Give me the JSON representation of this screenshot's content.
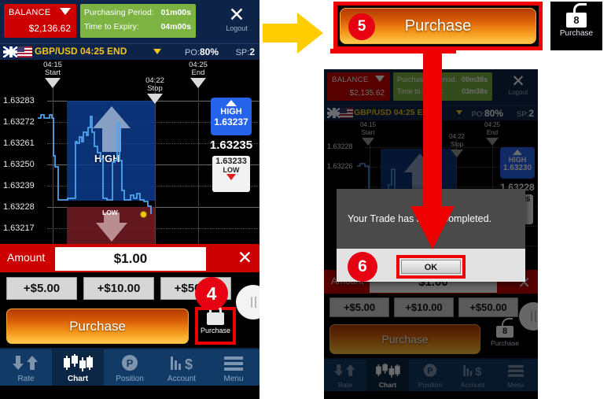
{
  "left_phone": {
    "header": {
      "balance_label": "BALANCE",
      "balance_value": "$2,136.62",
      "purchasing_period_label": "Purchasing Period:",
      "purchasing_period_value": "01m00s",
      "time_to_expiry_label": "Time to Expiry:",
      "time_to_expiry_value": "04m00s",
      "logout_label": "Logout",
      "close_icon": "close-x-icon"
    },
    "pair_bar": {
      "pair": "GBP/USD 04:25 END",
      "po_label": "PO:",
      "po_value": "80%",
      "sp_label": "SP:",
      "sp_value": "2"
    },
    "chart": {
      "markers": [
        {
          "time": "04:15",
          "name": "Start"
        },
        {
          "time": "04:22",
          "name": "Stop"
        },
        {
          "time": "04:25",
          "name": "End"
        }
      ],
      "high_zone_label": "HIGH",
      "low_zone_label": "LOW",
      "high_badge_label": "HIGH",
      "high_badge_value": "1.63237",
      "mid_value": "1.63235",
      "low_badge_value": "1.63233",
      "low_badge_label": "LOW"
    },
    "amount": {
      "label": "Amount",
      "value": "$1.00",
      "clear_icon": "close-x-icon"
    },
    "quick_buttons": [
      "+$5.00",
      "+$10.00",
      "+$50.00"
    ],
    "purchase_button": "Purchase",
    "lock": {
      "label": "Purchase",
      "icon": "padlock-closed-icon"
    },
    "nav": [
      {
        "label": "Rate",
        "icon": "arrows-up-down-icon",
        "active": false
      },
      {
        "label": "Chart",
        "icon": "candlestick-icon",
        "active": true
      },
      {
        "label": "Position",
        "icon": "p-circle-icon",
        "active": false
      },
      {
        "label": "Account",
        "icon": "bars-dollar-icon",
        "active": false
      },
      {
        "label": "Menu",
        "icon": "hamburger-icon",
        "active": false
      }
    ],
    "badge": "4"
  },
  "right_phone": {
    "header": {
      "balance_label": "BALANCE",
      "balance_value": "$2,135.62",
      "purchasing_period_label": "Purchasing Period:",
      "purchasing_period_value": "00m38s",
      "time_to_expiry_label": "Time to Expiry:",
      "time_to_expiry_value": "03m38s",
      "logout_label": "Logout",
      "close_icon": "close-x-icon"
    },
    "pair_bar": {
      "pair": "GBP/USD 04:25 END",
      "po_label": "PO:",
      "po_value": "80%",
      "sp_label": "SP:",
      "sp_value": "2"
    },
    "chart": {
      "markers": [
        {
          "time": "04:15",
          "name": "Start"
        },
        {
          "time": "04:22",
          "name": "Stop"
        },
        {
          "time": "04:25",
          "name": "End"
        }
      ],
      "high_badge_label": "HIGH",
      "high_badge_value": "1.63230",
      "mid_value": "1.63228",
      "low_badge_value": "1.63226"
    },
    "amount": {
      "label": "Amount",
      "value": "$1.00",
      "clear_icon": "close-x-icon"
    },
    "quick_buttons": [
      "+$5.00",
      "+$10.00",
      "+$50.00"
    ],
    "purchase_button": "Purchase",
    "lock": {
      "label": "Purchase",
      "badge": "8",
      "icon": "padlock-open-icon"
    },
    "nav": [
      {
        "label": "Rate",
        "icon": "arrows-up-down-icon",
        "active": false
      },
      {
        "label": "Chart",
        "icon": "candlestick-icon",
        "active": true
      },
      {
        "label": "Position",
        "icon": "p-circle-icon",
        "active": false
      },
      {
        "label": "Account",
        "icon": "bars-dollar-icon",
        "active": false
      },
      {
        "label": "Menu",
        "icon": "hamburger-icon",
        "active": false
      }
    ],
    "dialog": {
      "message": "Your Trade has been Completed.",
      "ok_label": "OK",
      "badge": "6"
    }
  },
  "callouts": {
    "top_purchase_button": "Purchase",
    "top_purchase_badge": "5",
    "top_lock_label": "Purchase",
    "top_lock_badge": "8",
    "flow_arrow_icon": "yellow-right-arrow-icon",
    "pointer_arrow_icon": "red-down-arrow-icon"
  },
  "chart_data": {
    "type": "line",
    "title": "GBP/USD 04:25 END",
    "ylabel": "",
    "xlabel": "",
    "ylim": [
      1.63217,
      1.63283
    ],
    "yticks": [
      "1.63283",
      "1.63272",
      "1.63261",
      "1.63250",
      "1.63239",
      "1.63228",
      "1.63217"
    ],
    "grid": true,
    "legend": "none",
    "series": [
      {
        "name": "GBP/USD rate",
        "values": [
          1.63272,
          1.63272,
          1.63274,
          1.63271,
          1.63273,
          1.63272,
          1.63272,
          1.6325,
          1.6324,
          1.63236,
          1.63236,
          1.63237,
          1.63237,
          1.63259,
          1.63258,
          1.63261,
          1.63257,
          1.63264,
          1.63264,
          1.63266,
          1.63274,
          1.63268,
          1.63262,
          1.6326,
          1.63258,
          1.63256,
          1.63254,
          1.63239,
          1.63238,
          1.63238,
          1.63252,
          1.63253,
          1.63268,
          1.63252,
          1.63242,
          1.63238,
          1.63237,
          1.63237,
          1.6324,
          1.63241,
          1.63239,
          1.63241,
          1.6324,
          1.63238,
          1.63238,
          1.63237,
          1.63234,
          1.63233
        ]
      }
    ],
    "annotations": [
      {
        "label": "HIGH",
        "type": "zone-up",
        "value": "1.63237"
      },
      {
        "label": "LOW",
        "type": "zone-down",
        "value": "1.63233"
      },
      {
        "label": "04:15 Start",
        "type": "vline"
      },
      {
        "label": "04:22 Stop",
        "type": "vline"
      },
      {
        "label": "04:25 End",
        "type": "vline"
      }
    ],
    "current_value": 1.63235
  }
}
